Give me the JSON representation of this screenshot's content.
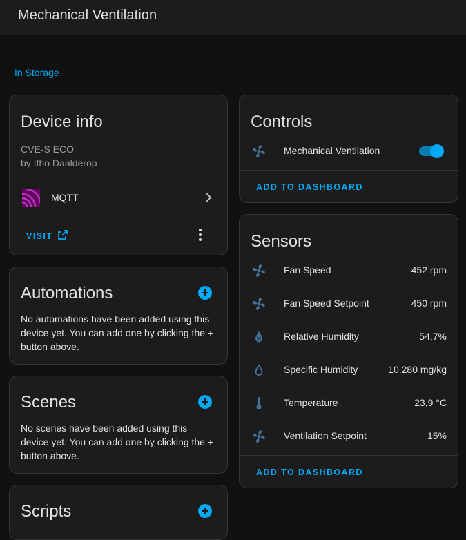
{
  "header": {
    "title": "Mechanical Ventilation"
  },
  "area": {
    "label": "In Storage"
  },
  "device_info": {
    "title": "Device info",
    "model": "CVE-S ECO",
    "manufacturer": "by Itho Daalderop",
    "integration": {
      "label": "MQTT",
      "icon": "mqtt-icon"
    },
    "visit_label": "VISIT"
  },
  "automations": {
    "title": "Automations",
    "empty_text": "No automations have been added using this device yet. You can add one by clicking the + button above."
  },
  "scenes": {
    "title": "Scenes",
    "empty_text": "No scenes have been added using this device yet. You can add one by clicking the + button above."
  },
  "scripts": {
    "title": "Scripts"
  },
  "controls": {
    "title": "Controls",
    "items": [
      {
        "label": "Mechanical Ventilation",
        "icon": "fan-icon",
        "state": "on"
      }
    ],
    "action_label": "ADD TO DASHBOARD"
  },
  "sensors": {
    "title": "Sensors",
    "items": [
      {
        "label": "Fan Speed",
        "value": "452 rpm",
        "icon": "fan-icon"
      },
      {
        "label": "Fan Speed Setpoint",
        "value": "450 rpm",
        "icon": "fan-icon"
      },
      {
        "label": "Relative Humidity",
        "value": "54,7%",
        "icon": "water-percent-icon"
      },
      {
        "label": "Specific Humidity",
        "value": "10.280 mg/kg",
        "icon": "water-drop-icon"
      },
      {
        "label": "Temperature",
        "value": "23,9 °C",
        "icon": "thermometer-icon"
      },
      {
        "label": "Ventilation Setpoint",
        "value": "15%",
        "icon": "fan-icon"
      }
    ],
    "action_label": "ADD TO DASHBOARD"
  },
  "colors": {
    "accent": "#03a9f4",
    "icon": "#44739e",
    "mqtt": "#660066"
  }
}
